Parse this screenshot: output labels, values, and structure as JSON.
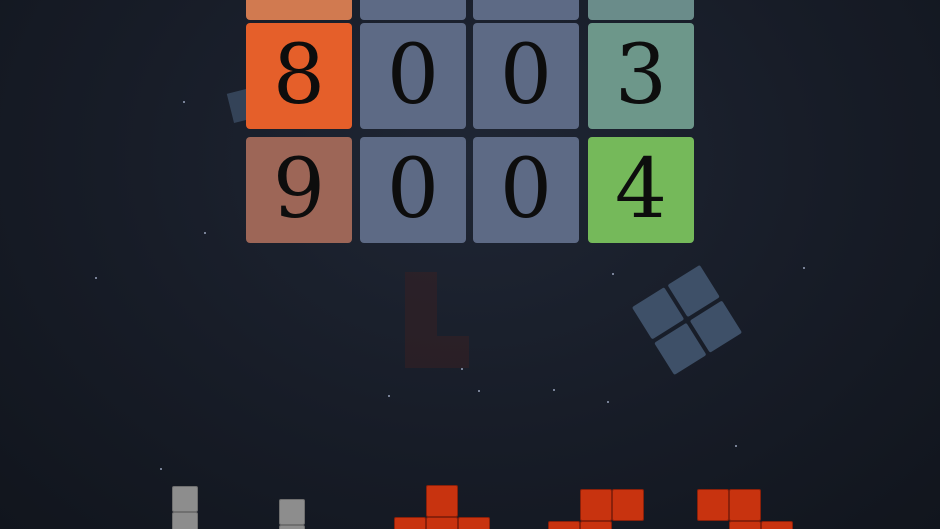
{
  "grid": {
    "rows": [
      {
        "tiles": [
          {
            "value": "",
            "color": "#d17a50"
          },
          {
            "value": "",
            "color": "#5d6a85"
          },
          {
            "value": "",
            "color": "#5d6a85"
          },
          {
            "value": "",
            "color": "#6a8c8a"
          }
        ]
      },
      {
        "tiles": [
          {
            "value": "8",
            "color": "#e55f2a"
          },
          {
            "value": "0",
            "color": "#5d6a85"
          },
          {
            "value": "0",
            "color": "#5d6a85"
          },
          {
            "value": "3",
            "color": "#6d978a"
          }
        ]
      },
      {
        "tiles": [
          {
            "value": "9",
            "color": "#9d6657"
          },
          {
            "value": "0",
            "color": "#5d6a85"
          },
          {
            "value": "0",
            "color": "#5d6a85"
          },
          {
            "value": "4",
            "color": "#75b95a"
          }
        ]
      }
    ]
  },
  "colors": {
    "background": "#171c27",
    "brick_red": "#c8330f",
    "brick_gray": "#8d8d8d",
    "falling_piece": "#3e5068"
  }
}
